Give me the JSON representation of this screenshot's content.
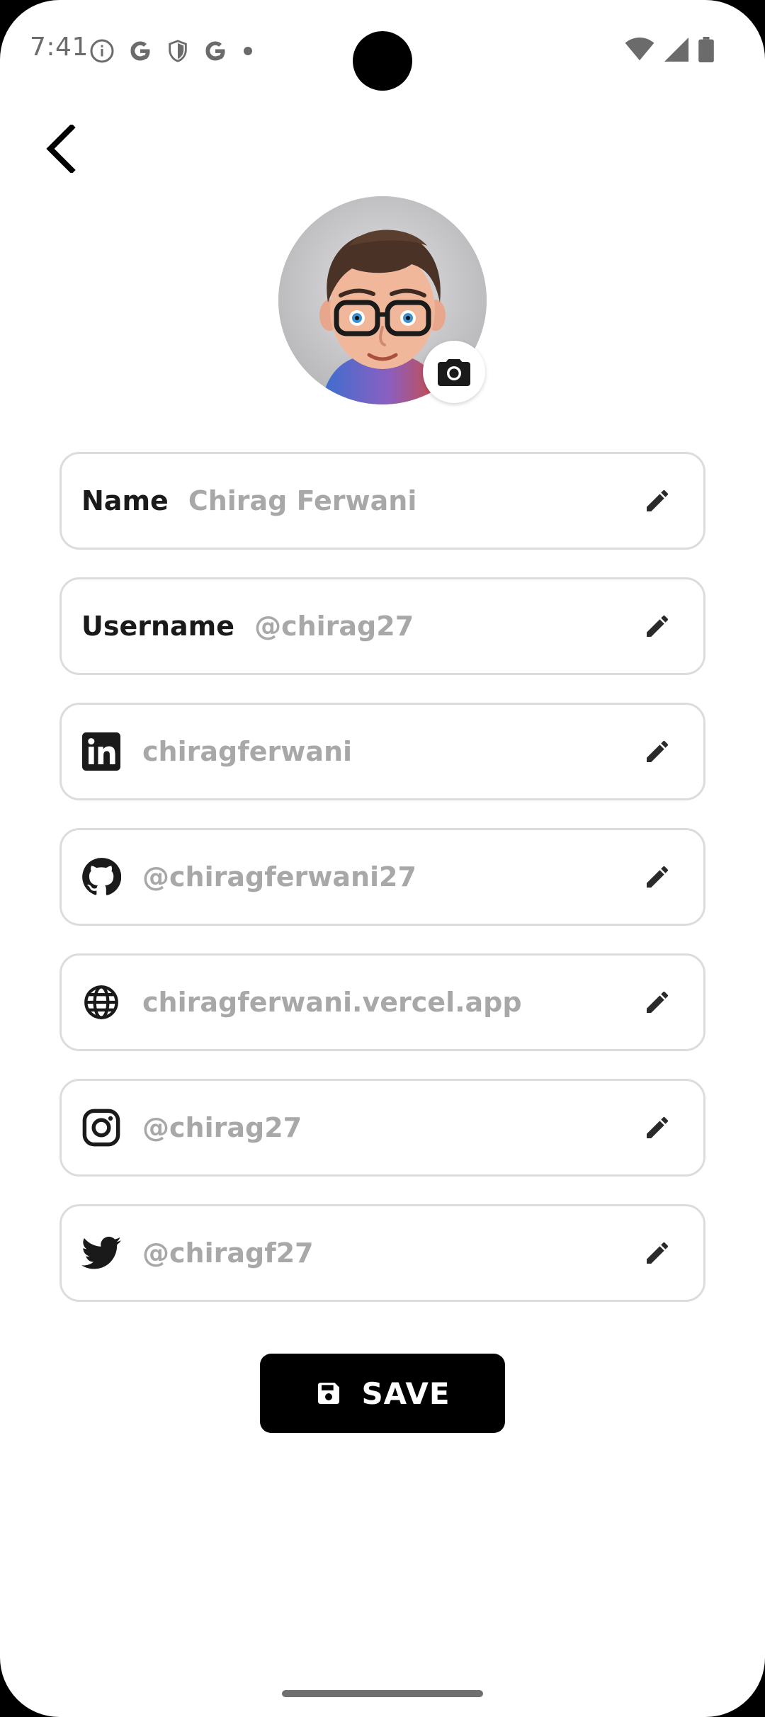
{
  "status_bar": {
    "time": "7:41",
    "left_icons": [
      "info-icon",
      "google-icon",
      "shield-icon",
      "google-icon",
      "dot-icon"
    ],
    "right_icons": [
      "wifi-icon",
      "signal-icon",
      "battery-icon"
    ]
  },
  "header": {
    "back_icon": "chevron-left-icon"
  },
  "profile": {
    "avatar": "avatar-image",
    "camera_icon": "camera-icon"
  },
  "fields": [
    {
      "label": "Name",
      "value": "Chirag Ferwani",
      "icon": null
    },
    {
      "label": "Username",
      "value": "@chirag27",
      "icon": null
    },
    {
      "label": null,
      "value": "chiragferwani",
      "icon": "linkedin-icon"
    },
    {
      "label": null,
      "value": "@chiragferwani27",
      "icon": "github-icon"
    },
    {
      "label": null,
      "value": "chiragferwani.vercel.app",
      "icon": "globe-icon"
    },
    {
      "label": null,
      "value": "@chirag27",
      "icon": "instagram-icon"
    },
    {
      "label": null,
      "value": "@chiragf27",
      "icon": "twitter-icon"
    }
  ],
  "save": {
    "label": "SAVE",
    "icon": "floppy-disk-icon"
  },
  "colors": {
    "background": "#ffffff",
    "field_border": "#dcdcdc",
    "value_text": "#a8a8a8",
    "label_text": "#1a1a1a",
    "button_bg": "#000000",
    "button_text": "#ffffff"
  }
}
